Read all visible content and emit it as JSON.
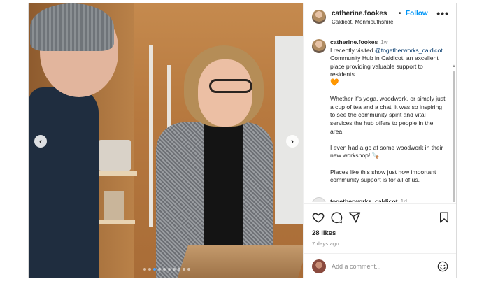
{
  "post": {
    "username": "catherine.fookes",
    "separator": "•",
    "follow_label": "Follow",
    "location": "Caldicot, Monmouthshire",
    "more_label": "•••"
  },
  "caption": {
    "username": "catherine.fookes",
    "time": "1w",
    "line1_pre": "I recently visited",
    "mention": "@togetherworks_caldicot",
    "line1_post": "Community Hub in Caldicot, an excellent place providing valuable support to residents.",
    "heart": "🧡",
    "para2": "Whether it's yoga, woodwork, or simply just a cup of tea and a chat, it was so inspiring to see the community spirit and vital services the hub offers to people in the area.",
    "para3": "I even had a go at some woodwork in their new workshop! 🪚",
    "para4": "Places like this show just how important community support is for all of us."
  },
  "reply": {
    "username": "togetherworks_caldicot",
    "time": "1d"
  },
  "carousel": {
    "prev_label": "‹",
    "next_label": "›",
    "dot_count": 10,
    "active_index": 2
  },
  "engagement": {
    "likes": "28 likes",
    "ago": "7 days ago"
  },
  "comment_box": {
    "placeholder": "Add a comment..."
  },
  "icons": [
    "heart-icon",
    "comment-icon",
    "share-icon",
    "bookmark-icon",
    "emoji-icon"
  ],
  "colors": {
    "link": "#0095f6",
    "mention": "#00376b",
    "active_dot": "#4aa3ff"
  }
}
